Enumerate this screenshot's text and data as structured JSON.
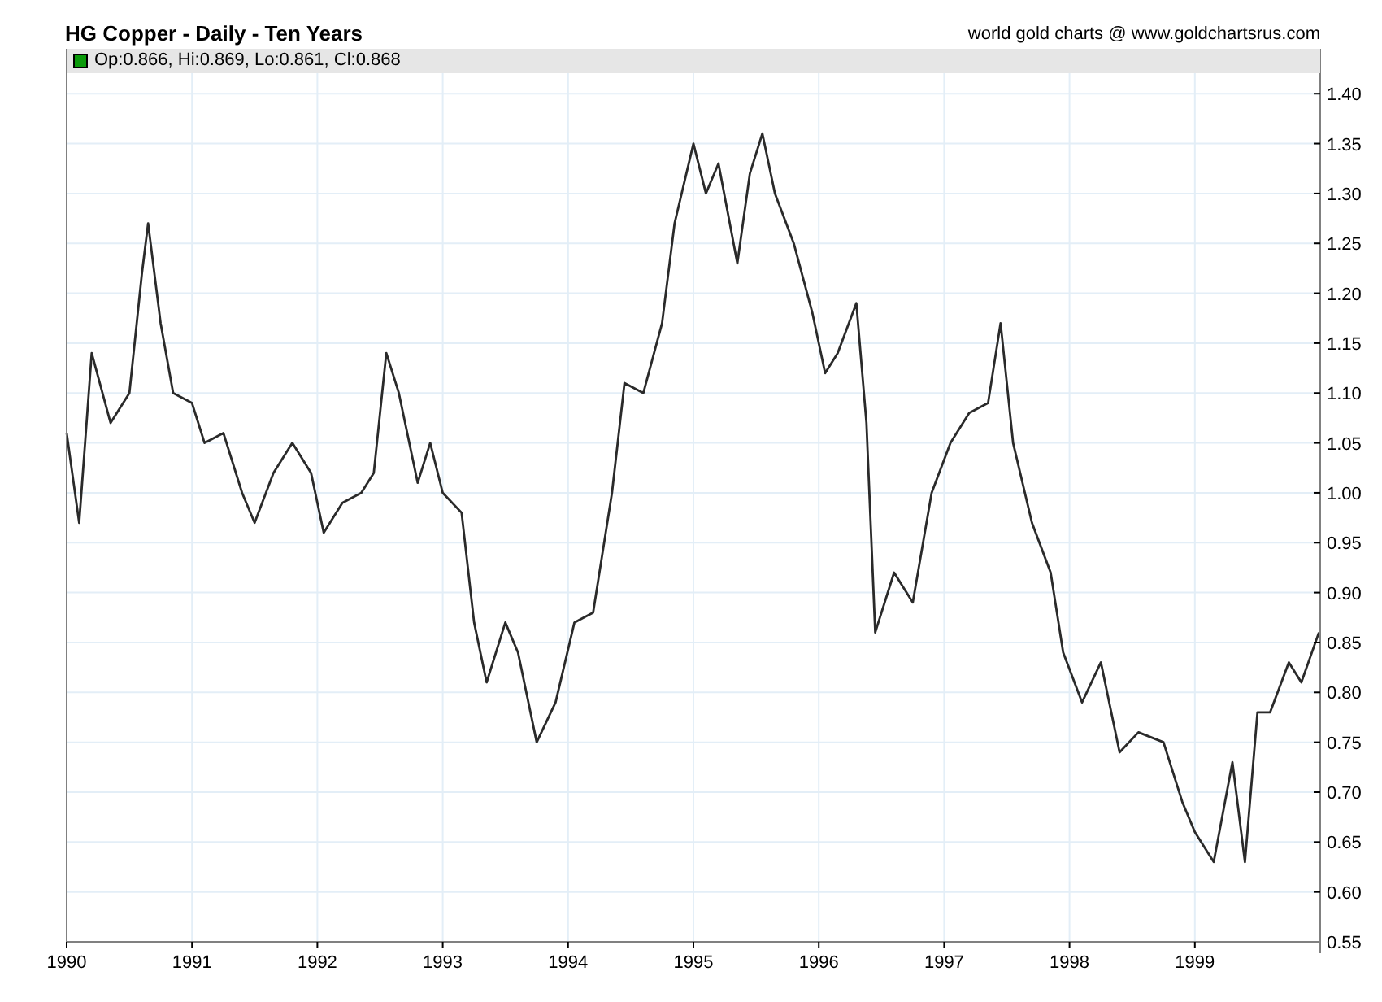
{
  "header": {
    "title": "HG Copper - Daily - Ten Years",
    "credit": "world gold charts @ www.goldchartsrus.com"
  },
  "legend": {
    "text": "Op:0.866, Hi:0.869, Lo:0.861, Cl:0.868"
  },
  "chart_data": {
    "type": "line",
    "xlim": [
      1990,
      2000
    ],
    "ylim": [
      0.55,
      1.445
    ],
    "xticks": [
      1990,
      1991,
      1992,
      1993,
      1994,
      1995,
      1996,
      1997,
      1998,
      1999
    ],
    "yticks": [
      {
        "value": 0.55,
        "label": "0.55"
      },
      {
        "value": 0.6,
        "label": "0.60"
      },
      {
        "value": 0.65,
        "label": "0.65"
      },
      {
        "value": 0.7,
        "label": "0.70"
      },
      {
        "value": 0.75,
        "label": "0.75"
      },
      {
        "value": 0.8,
        "label": "0.80"
      },
      {
        "value": 0.85,
        "label": "0.85"
      },
      {
        "value": 0.9,
        "label": "0.90"
      },
      {
        "value": 0.95,
        "label": "0.95"
      },
      {
        "value": 1.0,
        "label": "1.00"
      },
      {
        "value": 1.05,
        "label": "1.05"
      },
      {
        "value": 1.1,
        "label": "1.10"
      },
      {
        "value": 1.15,
        "label": "1.15"
      },
      {
        "value": 1.2,
        "label": "1.20"
      },
      {
        "value": 1.25,
        "label": "1.25"
      },
      {
        "value": 1.3,
        "label": "1.30"
      },
      {
        "value": 1.35,
        "label": "1.35"
      },
      {
        "value": 1.4,
        "label": "1.40"
      }
    ],
    "x": [
      1990.0,
      1990.1,
      1990.2,
      1990.35,
      1990.5,
      1990.6,
      1990.65,
      1990.75,
      1990.85,
      1991.0,
      1991.1,
      1991.25,
      1991.4,
      1991.5,
      1991.65,
      1991.8,
      1991.95,
      1992.05,
      1992.2,
      1992.35,
      1992.45,
      1992.55,
      1992.65,
      1992.8,
      1992.9,
      1993.0,
      1993.15,
      1993.25,
      1993.35,
      1993.5,
      1993.6,
      1993.75,
      1993.9,
      1994.05,
      1994.2,
      1994.35,
      1994.45,
      1994.6,
      1994.75,
      1994.85,
      1995.0,
      1995.1,
      1995.2,
      1995.35,
      1995.45,
      1995.55,
      1995.65,
      1995.8,
      1995.95,
      1996.05,
      1996.15,
      1996.3,
      1996.38,
      1996.45,
      1996.6,
      1996.75,
      1996.9,
      1997.05,
      1997.2,
      1997.35,
      1997.45,
      1997.55,
      1997.7,
      1997.85,
      1997.95,
      1998.1,
      1998.25,
      1998.4,
      1998.55,
      1998.75,
      1998.9,
      1999.0,
      1999.15,
      1999.3,
      1999.4,
      1999.5,
      1999.6,
      1999.75,
      1999.85,
      1999.99
    ],
    "grid": true,
    "values": [
      1.06,
      0.97,
      1.14,
      1.07,
      1.1,
      1.22,
      1.27,
      1.17,
      1.1,
      1.09,
      1.05,
      1.06,
      1.0,
      0.97,
      1.02,
      1.05,
      1.02,
      0.96,
      0.99,
      1.0,
      1.02,
      1.14,
      1.1,
      1.01,
      1.05,
      1.0,
      0.98,
      0.87,
      0.81,
      0.87,
      0.84,
      0.75,
      0.79,
      0.87,
      0.88,
      1.0,
      1.11,
      1.1,
      1.17,
      1.27,
      1.35,
      1.3,
      1.33,
      1.23,
      1.32,
      1.36,
      1.3,
      1.25,
      1.18,
      1.12,
      1.14,
      1.19,
      1.07,
      0.86,
      0.92,
      0.89,
      1.0,
      1.05,
      1.08,
      1.09,
      1.17,
      1.05,
      0.97,
      0.92,
      0.84,
      0.79,
      0.83,
      0.74,
      0.76,
      0.75,
      0.69,
      0.66,
      0.63,
      0.73,
      0.63,
      0.78,
      0.78,
      0.83,
      0.81,
      0.86
    ]
  }
}
